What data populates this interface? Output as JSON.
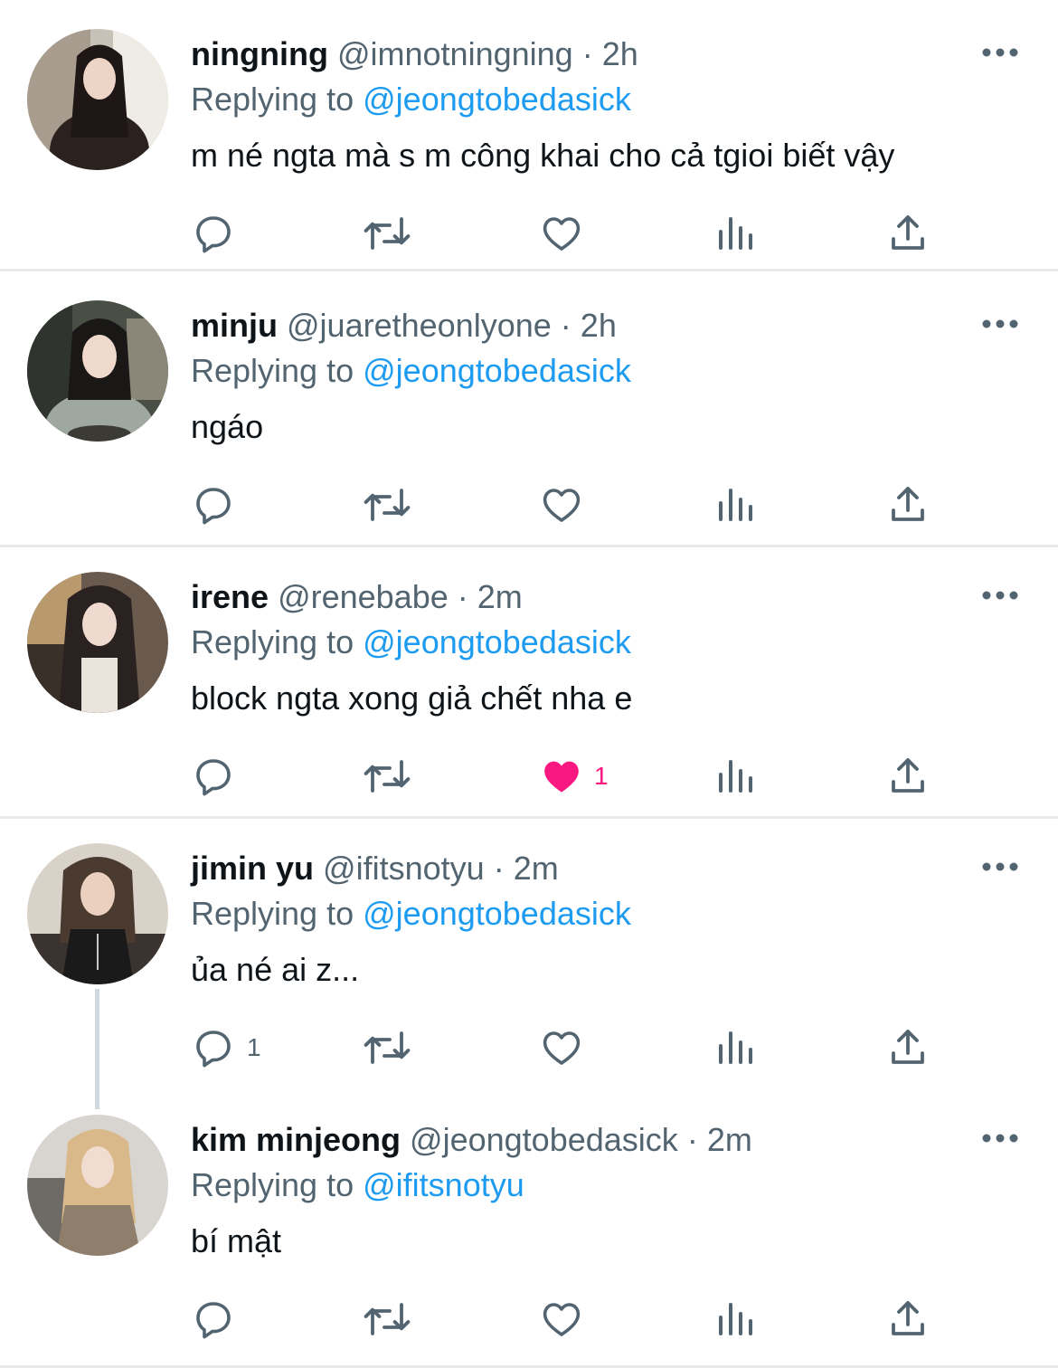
{
  "colors": {
    "accent": "#1d9bf0",
    "like": "#f91880",
    "text": "#0f1419",
    "muted": "#536471",
    "divider": "#e7e9ea"
  },
  "tweets": [
    {
      "name": "ningning",
      "handle": "@imnotningning",
      "sep": "·",
      "time": "2h",
      "reply_prefix": "Replying to",
      "reply_to": "@jeongtobedasick",
      "text": "m né ngta mà s m công khai cho cả tgioi biết vậy",
      "reply_count": "",
      "like_count": "",
      "liked": false
    },
    {
      "name": "minju",
      "handle": "@juaretheonlyone",
      "sep": "·",
      "time": "2h",
      "reply_prefix": "Replying to",
      "reply_to": "@jeongtobedasick",
      "text": "ngáo",
      "reply_count": "",
      "like_count": "",
      "liked": false
    },
    {
      "name": "irene",
      "handle": "@renebabe",
      "sep": "·",
      "time": "2m",
      "reply_prefix": "Replying to",
      "reply_to": "@jeongtobedasick",
      "text": "block ngta xong giả chết nha e",
      "reply_count": "",
      "like_count": "1",
      "liked": true
    },
    {
      "name": "jimin yu",
      "handle": "@ifitsnotyu",
      "sep": "·",
      "time": "2m",
      "reply_prefix": "Replying to",
      "reply_to": "@jeongtobedasick",
      "text": "ủa né ai z...",
      "reply_count": "1",
      "like_count": "",
      "liked": false
    },
    {
      "name": "kim minjeong",
      "handle": "@jeongtobedasick",
      "sep": "·",
      "time": "2m",
      "reply_prefix": "Replying to",
      "reply_to": "@ifitsnotyu",
      "text": "bí mật",
      "reply_count": "",
      "like_count": "",
      "liked": false
    }
  ],
  "icons": {
    "reply": "reply-bubble-icon",
    "retweet": "retweet-icon",
    "like": "heart-icon",
    "views": "views-bar-icon",
    "share": "share-icon",
    "more": "more-dots-icon"
  }
}
